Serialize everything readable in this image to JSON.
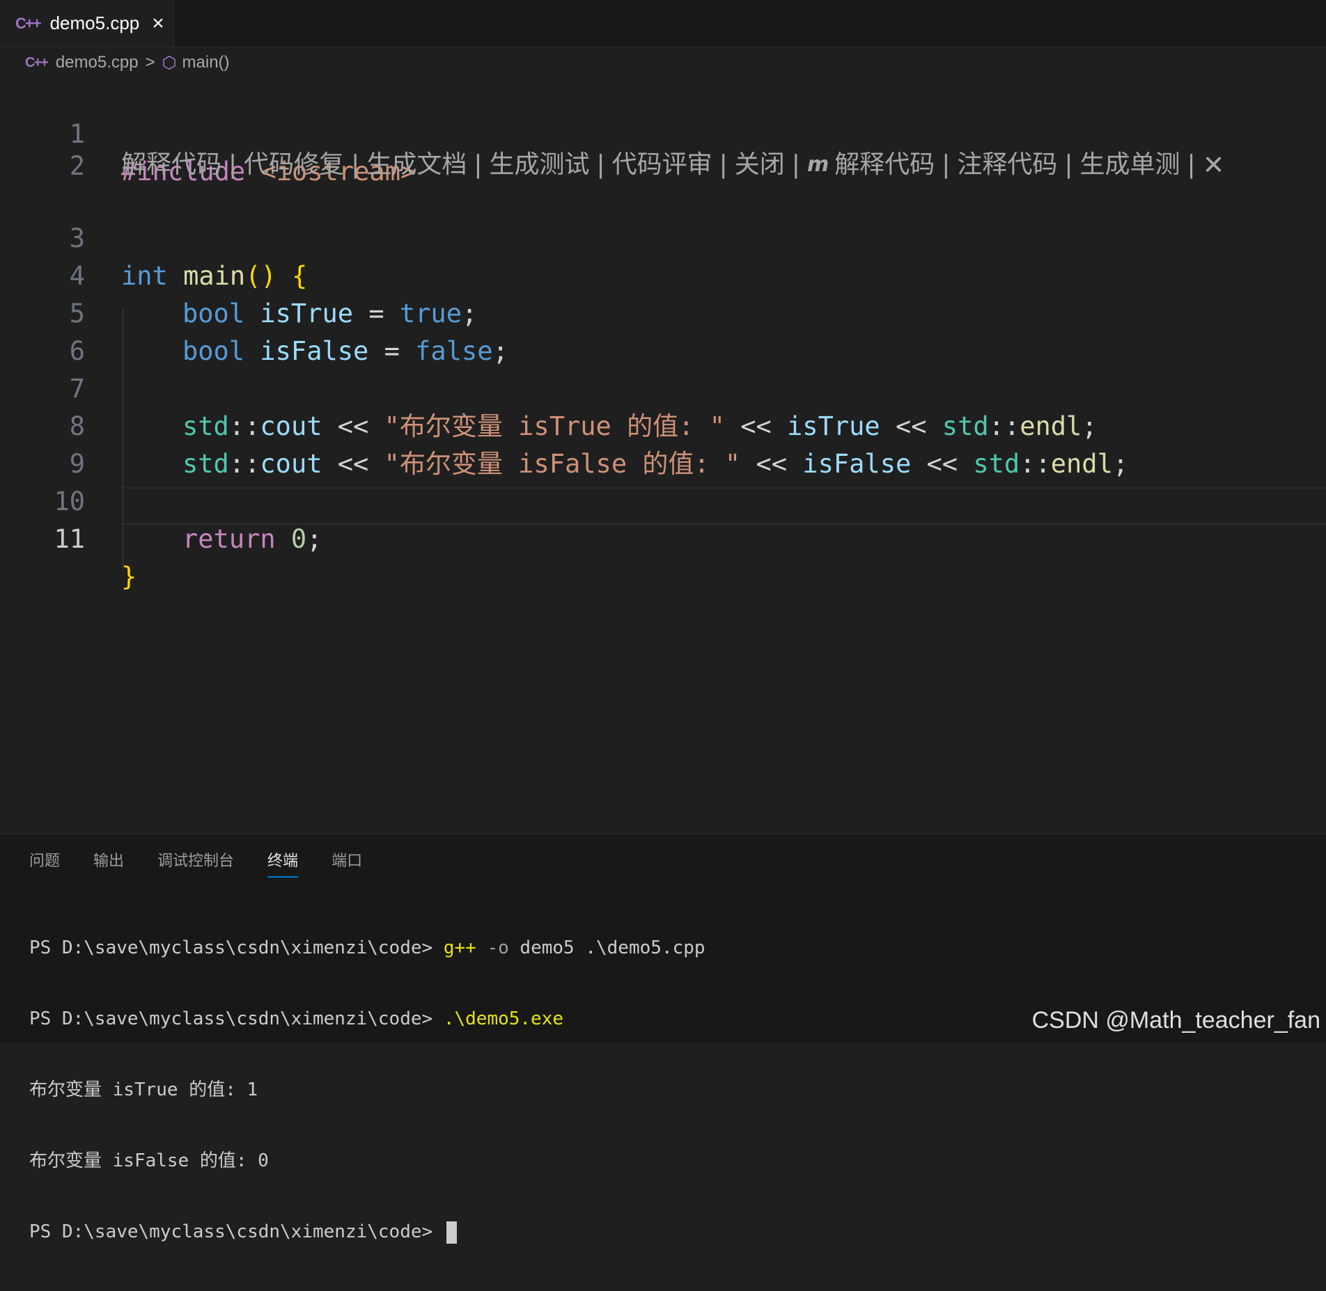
{
  "tab": {
    "icon": "C++",
    "label": "demo5.cpp",
    "close": "×"
  },
  "breadcrumb": {
    "file_icon": "C++",
    "file": "demo5.cpp",
    "separator": ">",
    "symbol_icon": "⬡",
    "symbol": "main()"
  },
  "editor": {
    "line_numbers": [
      "1",
      "2",
      "3",
      "4",
      "5",
      "6",
      "7",
      "8",
      "9",
      "10",
      "11"
    ],
    "active_line": "11",
    "codelens": {
      "items_a": [
        "解释代码",
        "代码修复",
        "生成文档",
        "生成测试",
        "代码评审",
        "关闭"
      ],
      "items_b": [
        "解释代码",
        "注释代码",
        "生成单测"
      ],
      "pipe": "|",
      "logo": "m",
      "close": "✕"
    },
    "code": {
      "l1_include": "#include",
      "l1_header": " <iostream>",
      "l3_int": "int",
      "l3_main": " main",
      "l3_paren": "()",
      "l3_brace": " {",
      "l4_type": "bool",
      "l4_var": " isTrue",
      "l4_eq": " = ",
      "l4_val": "true",
      "l4_semi": ";",
      "l5_type": "bool",
      "l5_var": " isFalse",
      "l5_eq": " = ",
      "l5_val": "false",
      "l5_semi": ";",
      "std": "std",
      "scope": "::",
      "cout": "cout",
      "shl": " << ",
      "l7_str": "\"布尔变量 isTrue 的值: \"",
      "l7_var": "isTrue",
      "endl": "endl",
      "semi": ";",
      "l8_str": "\"布尔变量 isFalse 的值: \"",
      "l8_var": "isFalse",
      "l10_return": "return",
      "l10_zero": " 0",
      "l10_semi": ";",
      "l11_brace": "}"
    }
  },
  "panel": {
    "tabs": [
      "问题",
      "输出",
      "调试控制台",
      "终端",
      "端口"
    ],
    "active_tab": "终端",
    "terminal": {
      "prompt": "PS D:\\save\\myclass\\csdn\\ximenzi\\code> ",
      "cmd1": "g++",
      "cmd1_flag": " -o",
      "cmd1_rest": " demo5 .\\demo5.cpp",
      "cmd2": ".\\demo5.exe",
      "out1": "布尔变量 isTrue 的值: 1",
      "out2": "布尔变量 isFalse 的值: 0"
    }
  },
  "watermark": "CSDN @Math_teacher_fan"
}
